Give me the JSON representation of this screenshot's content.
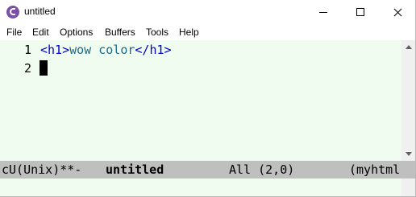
{
  "window": {
    "title": "untitled"
  },
  "menubar": {
    "items": [
      "File",
      "Edit",
      "Options",
      "Buffers",
      "Tools",
      "Help"
    ]
  },
  "editor": {
    "lines": [
      {
        "number": "1",
        "open_tag": "<h1>",
        "text": "wow color",
        "close_tag": "</h1>"
      },
      {
        "number": "2"
      }
    ]
  },
  "modeline": {
    "status": "cU(Unix)**-",
    "buffer_name": "untitled",
    "position": "All (2,0)",
    "mode": "(myhtml"
  },
  "colors": {
    "editor_bg": "#f0fcf0",
    "tag": "#0000d0",
    "text": "#1a6a8a",
    "modeline_bg": "#bfbfbf"
  }
}
